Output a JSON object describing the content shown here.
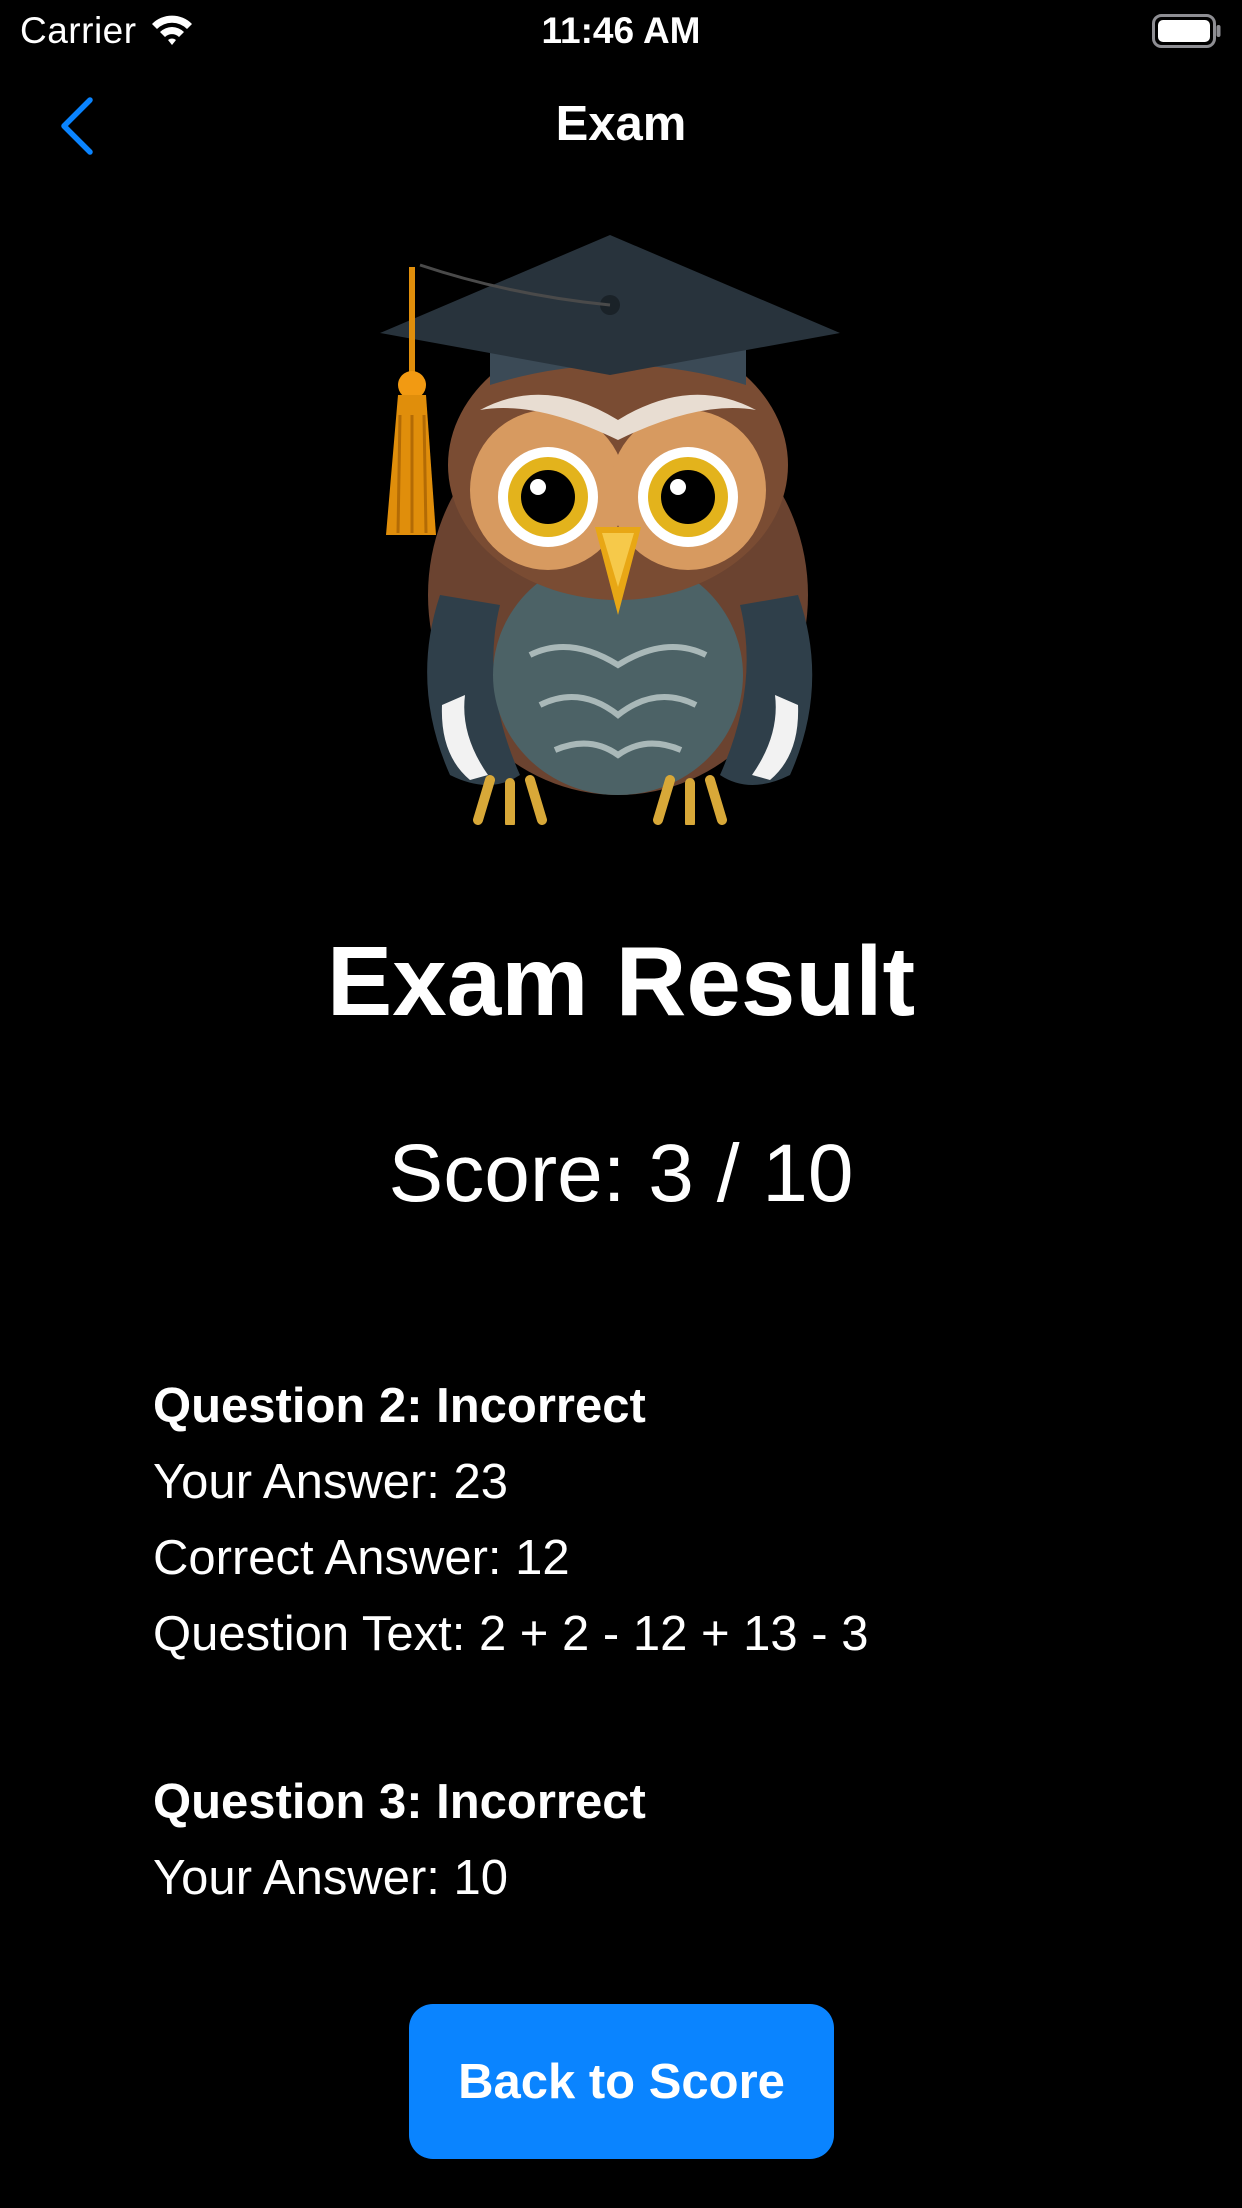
{
  "status_bar": {
    "carrier": "Carrier",
    "time": "11:46 AM",
    "icons": [
      "wifi-icon",
      "battery-icon"
    ]
  },
  "nav": {
    "title": "Exam",
    "back_icon": "chevron-left-icon",
    "accent_color": "#0a84ff"
  },
  "illustration": {
    "icon": "graduation-owl-icon"
  },
  "result": {
    "title": "Exam Result",
    "score": "Score: 3 / 10"
  },
  "questions": [
    {
      "header": "Question 2: Incorrect",
      "your_answer": "Your Answer: 23",
      "correct_answer": "Correct Answer: 12",
      "question_text": "Question Text: 2 + 2 - 12 + 13 - 3"
    },
    {
      "header": "Question 3: Incorrect",
      "your_answer": "Your Answer: 10"
    }
  ],
  "buttons": {
    "back_to_score": "Back to Score",
    "color": "#0a84ff"
  }
}
